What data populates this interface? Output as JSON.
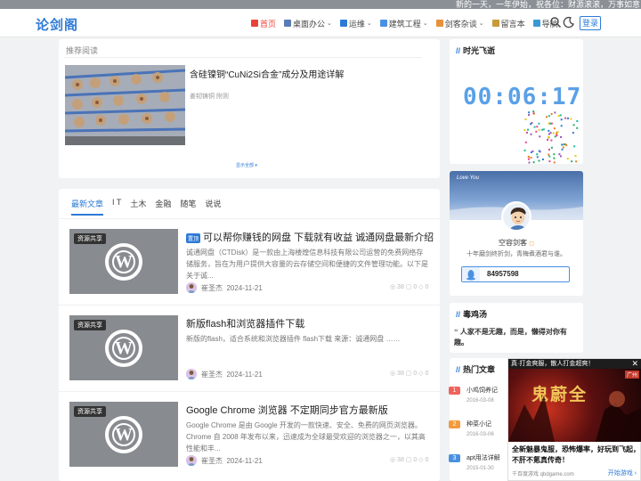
{
  "topbar": {
    "marquee": "新的一天，一年伊始，祝各位：财源滚滚，万事如意，健康长寿"
  },
  "header": {
    "logo": "论剑阁",
    "nav": [
      {
        "label": "首页",
        "icon": "home-icon",
        "active": true,
        "dropdown": false
      },
      {
        "label": "桌面办公",
        "icon": "desktop-icon",
        "active": false,
        "dropdown": true
      },
      {
        "label": "运维",
        "icon": "ops-icon",
        "active": false,
        "dropdown": true
      },
      {
        "label": "建筑工程",
        "icon": "building-icon",
        "active": false,
        "dropdown": true
      },
      {
        "label": "剑客杂谈",
        "icon": "chat-icon",
        "active": false,
        "dropdown": true
      },
      {
        "label": "留言本",
        "icon": "guestbook-icon",
        "active": false,
        "dropdown": false
      },
      {
        "label": "导航",
        "icon": "nav-icon",
        "active": false,
        "dropdown": false
      }
    ],
    "login": "登录"
  },
  "recommend": {
    "section_title": "推荐阅读",
    "headline": "含硅镍铜“CuNi2Si合金”成分及用途详解",
    "meta": "姜韧铸铜   附则",
    "more": "显示全部 ▾"
  },
  "tabs": [
    "最新文章",
    "I T",
    "土木",
    "金融",
    "随笔",
    "说说"
  ],
  "articles": [
    {
      "tag": "资源共享",
      "pinned": "置顶",
      "title": "可以帮你赚钱的网盘 下载就有收益 诚通网盘最新介绍",
      "excerpt": "诚通网盘（CTDisk）是一款由上海楼煌信息科技有限公司运营的免费网络存储服务，旨在为用户提供大容量的云存储空间和便捷的文件管理功能。以下是关于诚...",
      "author": "崔圣杰",
      "date": "2024-11-21",
      "stats": "◎ 38  ▢ 0  ◇ 0"
    },
    {
      "tag": "资源共享",
      "pinned": "",
      "title": "新版flash和浏览器插件下载",
      "excerpt": "新版的flash，适合系统和浏览器插件 flash下载 来源：诚通网盘 ……",
      "author": "崔圣杰",
      "date": "2024-11-21",
      "stats": "◎ 38  ▢ 0  ◇ 0"
    },
    {
      "tag": "资源共享",
      "pinned": "",
      "title": "Google Chrome 浏览器 不定期同步官方最新版",
      "excerpt": "Google Chrome 是由 Google 开发的一款快速、安全、免费的网页浏览器。Chrome 自 2008 年发布以来，迅速成为全球最受欢迎的浏览器之一，以其高性能和丰...",
      "author": "崔圣杰",
      "date": "2024-11-21",
      "stats": "◎ 38  ▢ 0  ◇ 0"
    }
  ],
  "sidebar": {
    "time_title": "时光飞逝",
    "clock": "00:06:17",
    "banner_script": "Love You",
    "profile_name": "空容剑客",
    "profile_bio": "十年磨剑终折剑，青梅煮酒君与谁。",
    "qq": "84957598",
    "quote_title": "毒鸡汤",
    "quote": "人家不是无趣，而是，懒得对你有趣。",
    "hot_title": "热门文章",
    "hot": [
      {
        "rank": "1",
        "title": "小鸡饲养记",
        "date": "2016-03-08",
        "color": "#f0625c"
      },
      {
        "rank": "2",
        "title": "种菜小记",
        "date": "2016-03-06",
        "color": "#f39a3c"
      },
      {
        "rank": "3",
        "title": "apt用法详解",
        "date": "2015-01-30",
        "color": "#4a90e2"
      }
    ]
  },
  "ad": {
    "top": "真·打金爽服，散人打金超爽！",
    "city": "广州",
    "glyph": "鬼蔚全",
    "text": "全新魅暴鬼服，恐怖爆率，好玩到飞起，不肝不氪真传奇！",
    "source": "千百度游戏 qbdgame.com",
    "cta": "开始游戏"
  }
}
